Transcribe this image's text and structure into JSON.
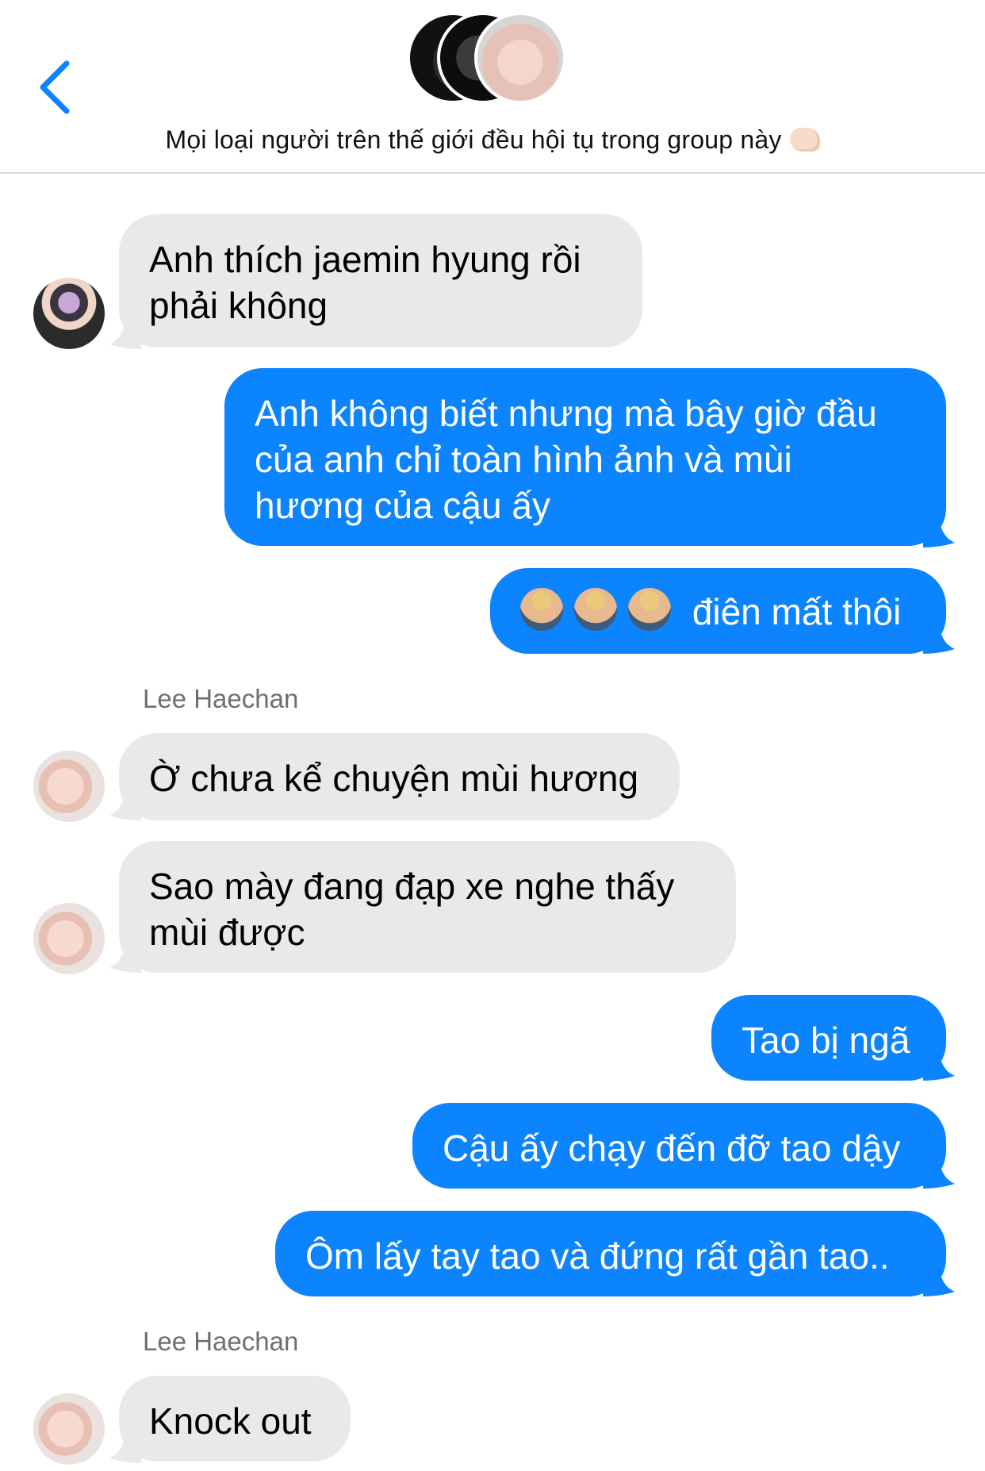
{
  "header": {
    "group_name": "Mọi loại người trên thế giới đều hội tụ trong group này",
    "back_icon": "chevron-left-icon",
    "thumb_emoji": "thumbs-up-icon"
  },
  "colors": {
    "outgoing": "#0b84fe",
    "incoming": "#e9e9eb",
    "accent": "#0b84fe"
  },
  "messages": [
    {
      "dir": "in",
      "text": "Anh thích jaemin hyung rồi phải không"
    },
    {
      "dir": "out",
      "text": "Anh không biết nhưng mà bây giờ đầu của anh chỉ toàn hình ảnh và mùi hương của cậu ấy"
    },
    {
      "dir": "out",
      "emoji": [
        "facepalm-icon",
        "facepalm-icon",
        "facepalm-icon"
      ],
      "text": "điên mất thôi"
    },
    {
      "dir": "in",
      "sender": "Lee Haechan",
      "text": "Ờ chưa kể chuyện mùi hương"
    },
    {
      "dir": "in",
      "text": "Sao mày đang đạp xe nghe thấy mùi được"
    },
    {
      "dir": "out",
      "text": "Tao bị ngã"
    },
    {
      "dir": "out",
      "text": "Cậu ấy chạy đến đỡ tao dậy"
    },
    {
      "dir": "out",
      "text": "Ôm lấy tay tao và đứng rất gần tao.."
    },
    {
      "dir": "in",
      "sender": "Lee Haechan",
      "text": "Knock out"
    }
  ],
  "bubble_lines": {
    "m0": [
      "Anh thích jaemin hyung rồi",
      "phải không"
    ],
    "m1": [
      "Anh không biết nhưng mà bây giờ đầu",
      "của anh chỉ toàn hình ảnh và mùi",
      "hương của cậu ấy"
    ],
    "m4": [
      "Sao mày đang đạp xe nghe thấy",
      "mùi được"
    ]
  }
}
